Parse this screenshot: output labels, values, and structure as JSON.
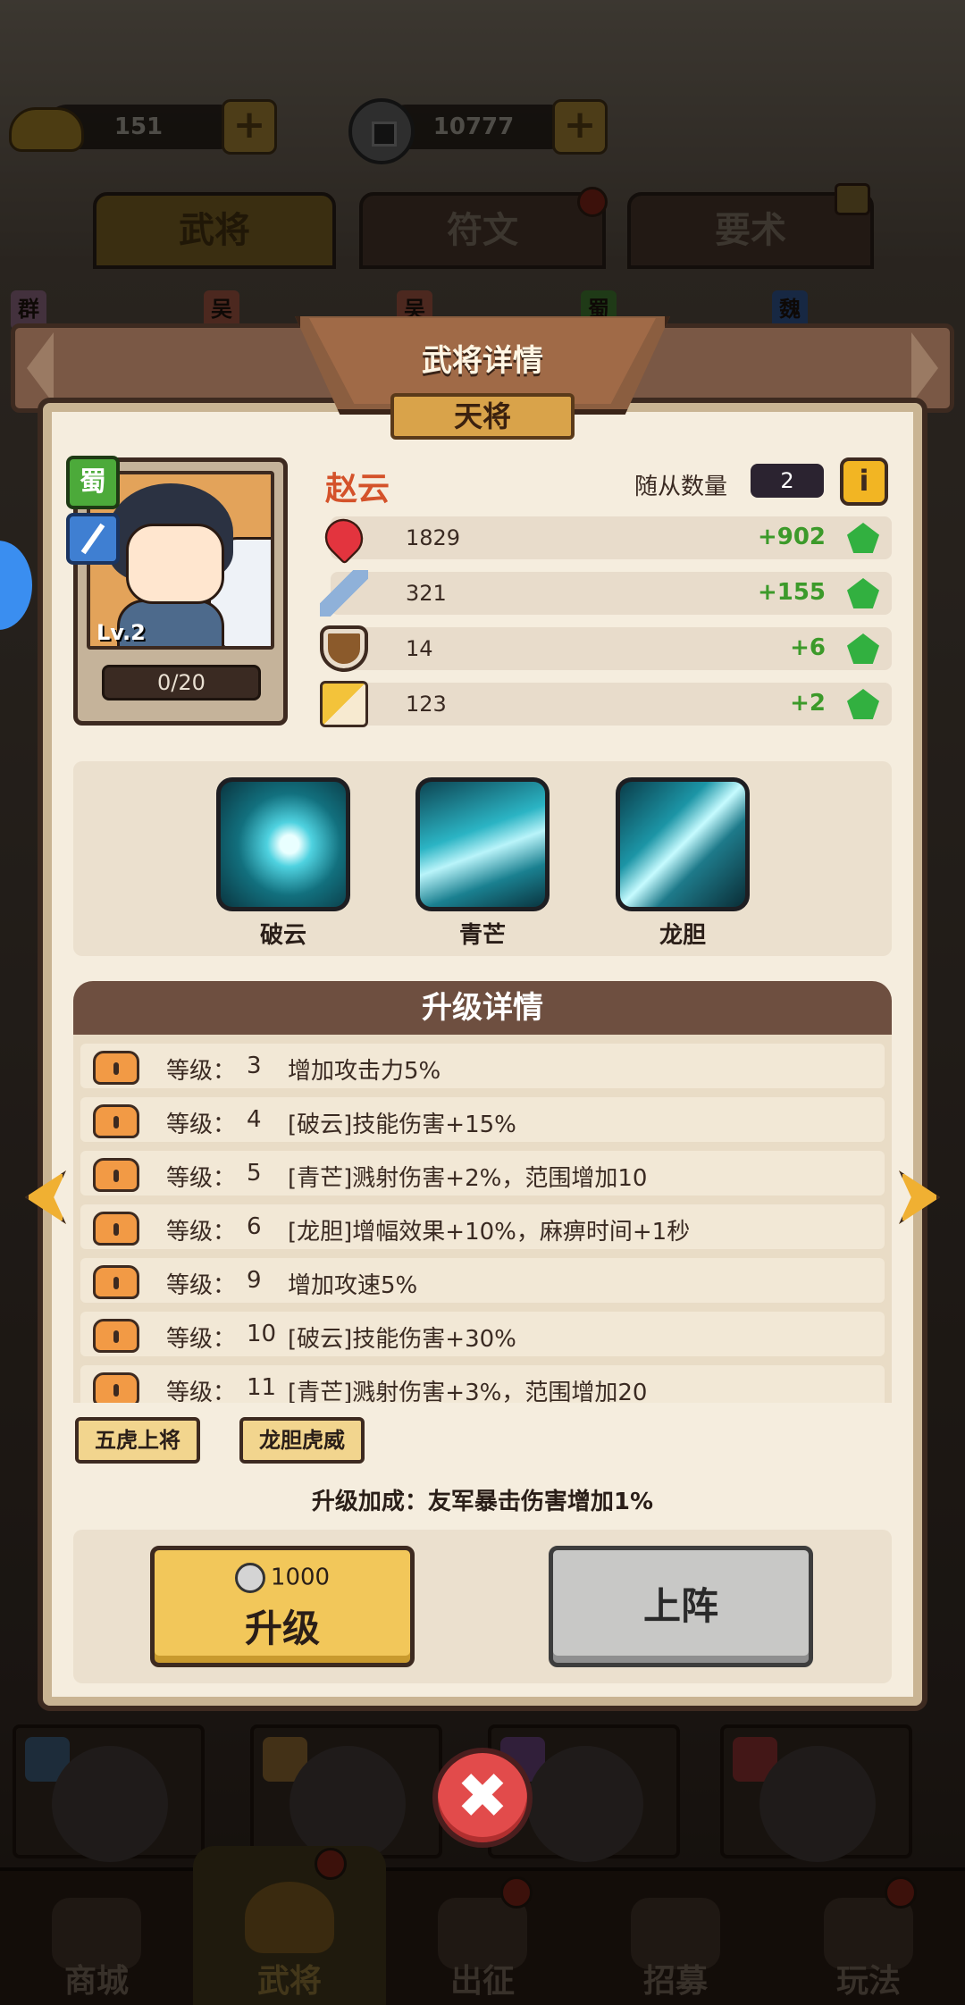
{
  "resources": {
    "gold_value": "151",
    "coin_value": "10777"
  },
  "top_tabs": [
    {
      "label": "武将"
    },
    {
      "label": "符文"
    },
    {
      "label": "要术"
    }
  ],
  "faction_tags": [
    "群",
    "吴",
    "吴",
    "蜀",
    "魏"
  ],
  "dialog": {
    "title": "武将详情",
    "rank": "天将"
  },
  "hero": {
    "name": "赵云",
    "faction": "蜀",
    "level": "Lv.2",
    "fragments": "0/20",
    "follower_label": "随从数量",
    "follower_count": "2",
    "info_icon": "i",
    "stats": [
      {
        "icon": "heart-icon",
        "value": "1829",
        "bonus": "+902"
      },
      {
        "icon": "sword-icon",
        "value": "321",
        "bonus": "+155"
      },
      {
        "icon": "shield-icon",
        "value": "14",
        "bonus": "+6"
      },
      {
        "icon": "boot-icon",
        "value": "123",
        "bonus": "+2"
      }
    ]
  },
  "skills": [
    {
      "name": "破云"
    },
    {
      "name": "青芒"
    },
    {
      "name": "龙胆"
    }
  ],
  "upgrade": {
    "header": "升级详情",
    "level_label": "等级：",
    "rows": [
      {
        "level": "3",
        "desc": "增加攻击力5%"
      },
      {
        "level": "4",
        "desc": "[破云]技能伤害+15%"
      },
      {
        "level": "5",
        "desc": "[青芒]溅射伤害+2%，范围增加10"
      },
      {
        "level": "6",
        "desc": "[龙胆]增幅效果+10%，麻痹时间+1秒"
      },
      {
        "level": "9",
        "desc": "增加攻速5%"
      },
      {
        "level": "10",
        "desc": "[破云]技能伤害+30%"
      },
      {
        "level": "11",
        "desc": "[青芒]溅射伤害+3%，范围增加20"
      }
    ]
  },
  "synergy_tags": [
    "五虎上将",
    "龙胆虎威"
  ],
  "bonus_text": "升级加成：友军暴击伤害增加1%",
  "buttons": {
    "upgrade_cost": "1000",
    "upgrade_label": "升级",
    "deploy_label": "上阵",
    "close_glyph": "✖"
  },
  "bottom_nav": [
    {
      "label": "商城"
    },
    {
      "label": "武将"
    },
    {
      "label": "出征"
    },
    {
      "label": "招募"
    },
    {
      "label": "玩法"
    }
  ],
  "colors": {
    "accent_gold": "#f2c75a",
    "hero_name": "#d4522a",
    "stat_bonus": "#3c9a2a",
    "close_red": "#e24b4b"
  }
}
